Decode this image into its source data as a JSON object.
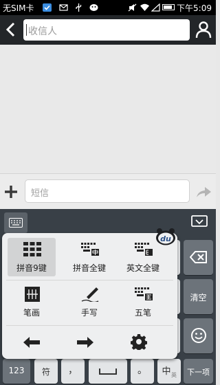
{
  "status_bar": {
    "carrier": "无SIM卡",
    "time": "下午5:09"
  },
  "header": {
    "recipient_placeholder": "收信人"
  },
  "compose": {
    "sms_placeholder": "短信"
  },
  "ime_menu": {
    "items": [
      {
        "label": "拼音9键",
        "icon": "pinyin-9key-icon",
        "selected": true
      },
      {
        "label": "拼音全键",
        "icon": "pinyin-full-icon",
        "selected": false
      },
      {
        "label": "英文全键",
        "icon": "english-full-icon",
        "selected": false
      },
      {
        "label": "笔画",
        "icon": "stroke-icon",
        "selected": false
      },
      {
        "label": "手写",
        "icon": "handwriting-icon",
        "selected": false
      },
      {
        "label": "五笔",
        "icon": "wubi-icon",
        "selected": false
      }
    ],
    "badge": "du"
  },
  "keyboard": {
    "clear": "清空",
    "num": "123",
    "symbol": "符",
    "comma": "，",
    "period": "。",
    "lang": "中",
    "lang_sub": "英",
    "next": "下一项"
  },
  "colors": {
    "header": "#232629",
    "keyboard": "#394047",
    "key": "#e3e5e7"
  }
}
